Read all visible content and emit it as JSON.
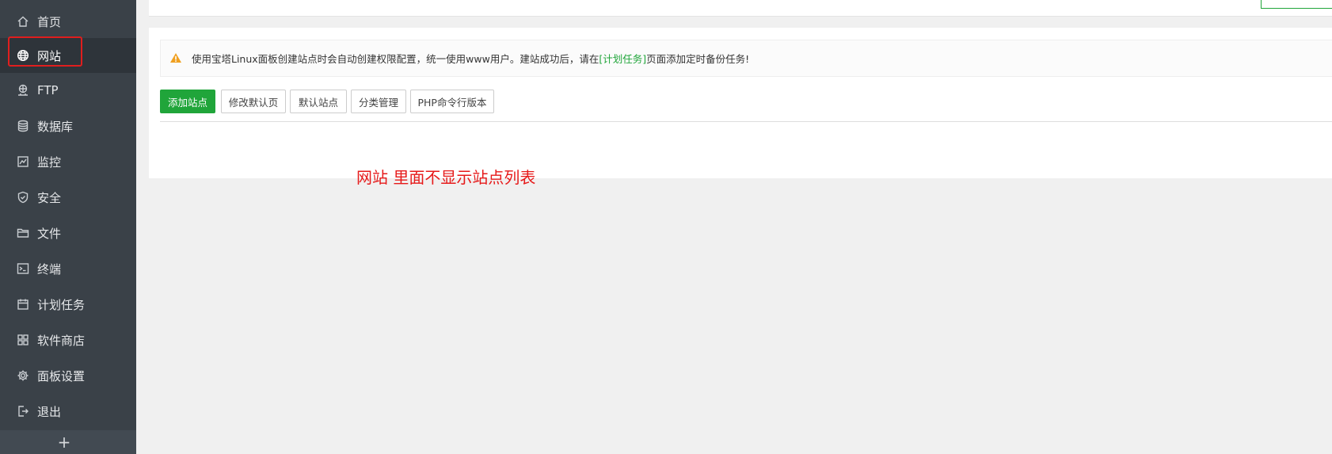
{
  "sidebar": {
    "items": [
      {
        "label": "首页",
        "icon": "home-icon"
      },
      {
        "label": "网站",
        "icon": "globe-icon",
        "active": true
      },
      {
        "label": "FTP",
        "icon": "ftp-icon"
      },
      {
        "label": "数据库",
        "icon": "database-icon"
      },
      {
        "label": "监控",
        "icon": "monitor-icon"
      },
      {
        "label": "安全",
        "icon": "shield-icon"
      },
      {
        "label": "文件",
        "icon": "folder-icon"
      },
      {
        "label": "终端",
        "icon": "terminal-icon"
      },
      {
        "label": "计划任务",
        "icon": "calendar-icon"
      },
      {
        "label": "软件商店",
        "icon": "apps-icon"
      },
      {
        "label": "面板设置",
        "icon": "gear-icon"
      },
      {
        "label": "退出",
        "icon": "logout-icon"
      }
    ],
    "add_label": "+"
  },
  "notice": {
    "text_before": "使用宝塔Linux面板创建站点时会自动创建权限配置，统一使用www用户。建站成功后，请在",
    "link_text": "[计划任务]",
    "text_after": "页面添加定时备份任务!"
  },
  "toolbar": {
    "add_site": "添加站点",
    "modify_default_page": "修改默认页",
    "default_site": "默认站点",
    "category_manage": "分类管理",
    "php_cli_version": "PHP命令行版本"
  },
  "annotation": "网站 里面不显示站点列表",
  "colors": {
    "sidebar_bg": "#3a4148",
    "accent_green": "#20a53a",
    "annotation_red": "#e61a1a",
    "warning_orange": "#f0a020"
  }
}
